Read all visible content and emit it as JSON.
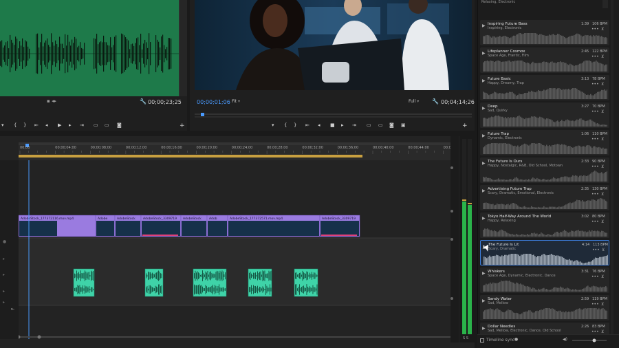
{
  "source": {
    "timecode": "00;00;23;25",
    "icons": [
      "marker-icon",
      "in-icon",
      "out-icon",
      "go-to-in-icon",
      "step-back-icon",
      "play-icon",
      "step-forward-icon",
      "go-to-out-icon",
      "insert-icon",
      "overwrite-icon",
      "export-frame-icon",
      "add-icon"
    ]
  },
  "program": {
    "timecode": "00;00;01;06",
    "zoom": "Fit",
    "resolution": "Full",
    "duration": "00;04;14;26"
  },
  "timeline": {
    "ruler_labels": [
      "00;00",
      "00;00;04;00",
      "00;00;08;00",
      "00;00;12;00",
      "00;00;16;00",
      "00;00;20;00",
      "00;00;24;00",
      "00;00;28;00",
      "00;00;32;00",
      "00;00;36;00",
      "00;00;40;00",
      "00;00;44;00",
      "00;00;48;00"
    ],
    "video_clips": [
      "AdobeStock_177372116.mov.mp4",
      "Adobe",
      "AdobeStock",
      "AdobeStock_3309719",
      "AdobeStock",
      "Adob",
      "AdobeStock_177372571.mov.mp4",
      "AdobeStock_3309719"
    ],
    "meter_label": "S S"
  },
  "music": {
    "top_partial_tags": "Relaxing, Electronic",
    "tracks": [
      {
        "title": "Inspiring Future Bass",
        "tags": "Inspiring, Electronic",
        "duration": "1:39",
        "bpm": "106 BPM"
      },
      {
        "title": "Lifeplanner Cosmox",
        "tags": "Space Age, Frantic, Film",
        "duration": "2:45",
        "bpm": "122 BPM"
      },
      {
        "title": "Future Basic",
        "tags": "Happy, Dreamy, Trap",
        "duration": "3:13",
        "bpm": "78 BPM"
      },
      {
        "title": "Deep",
        "tags": "Sad, Quirky",
        "duration": "3:27",
        "bpm": "70 BPM"
      },
      {
        "title": "Future Trap",
        "tags": "Dynamic, Electronic",
        "duration": "1:06",
        "bpm": "110 BPM"
      },
      {
        "title": "The Future Is Ours",
        "tags": "Happy, Nostalgic, R&B, Old School, Motown",
        "duration": "2:33",
        "bpm": "90 BPM"
      },
      {
        "title": "Advertising Future Trap",
        "tags": "Scary, Dramatic, Emotional, Electronic",
        "duration": "2:35",
        "bpm": "130 BPM"
      },
      {
        "title": "Tokyo Half-Way Around The World",
        "tags": "Happy, Relaxing",
        "duration": "3:02",
        "bpm": "80 BPM"
      },
      {
        "title": "The Future Is Lit",
        "tags": "Scary, Dramatic",
        "duration": "4:14",
        "bpm": "113 BPM"
      },
      {
        "title": "Whiskers",
        "tags": "Space Age, Dynamic, Electronic, Dance",
        "duration": "3:31",
        "bpm": "76 BPM"
      },
      {
        "title": "Sandy Water",
        "tags": "Sad, Mellow",
        "duration": "2:59",
        "bpm": "119 BPM"
      },
      {
        "title": "Dollar Needles",
        "tags": "Sad, Mellow, Electronic, Dance, Old School",
        "duration": "2:26",
        "bpm": "83 BPM"
      }
    ],
    "timeline_sync_label": "Timeline sync"
  },
  "colors": {
    "source_bg": "#1e7a4a",
    "video_clip": "#9a7be0",
    "audio_clip": "#3fd3a8",
    "playhead": "#4a9bff",
    "selected_border": "#3c7bd6"
  }
}
